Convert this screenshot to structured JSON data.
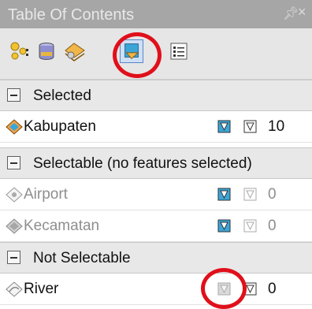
{
  "window": {
    "title": "Table Of Contents",
    "pin_glyph": " ↕",
    "close_glyph": "×"
  },
  "toolbar": {
    "buttons": [
      {
        "icon": "list-by-drawing-order-icon",
        "selected": false
      },
      {
        "icon": "list-by-source-icon",
        "selected": false
      },
      {
        "icon": "list-by-visibility-icon",
        "selected": false
      },
      {
        "icon": "list-by-selection-icon",
        "selected": true
      },
      {
        "icon": "options-icon",
        "selected": false
      }
    ],
    "highlight_color": "#e0101a"
  },
  "groups": [
    {
      "label": "Selected",
      "layers": [
        {
          "name": "Kabupaten",
          "count": "10",
          "selectable": true,
          "dim": false,
          "icon": "polygon-layer-selected-icon"
        }
      ]
    },
    {
      "label": "Selectable (no features selected)",
      "layers": [
        {
          "name": "Airport",
          "count": "0",
          "selectable": true,
          "dim": true,
          "icon": "point-layer-icon"
        },
        {
          "name": "Kecamatan",
          "count": "0",
          "selectable": true,
          "dim": true,
          "icon": "polygon-layer-icon"
        }
      ]
    },
    {
      "label": "Not Selectable",
      "layers": [
        {
          "name": "River",
          "count": "0",
          "selectable": false,
          "dim": false,
          "icon": "line-layer-icon"
        }
      ]
    }
  ]
}
